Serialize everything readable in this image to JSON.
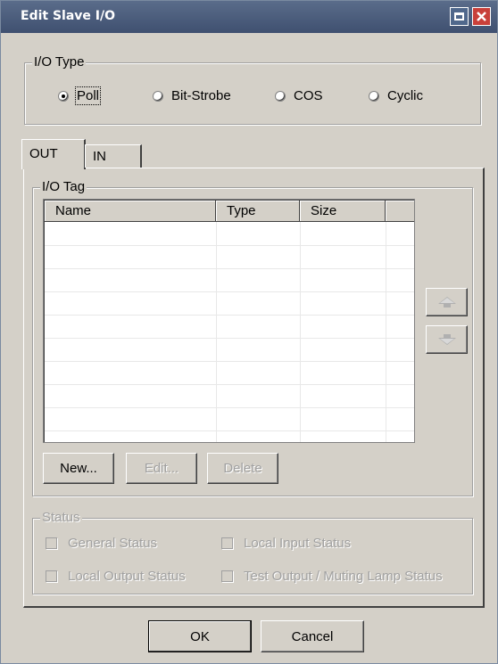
{
  "window": {
    "title": "Edit Slave I/O"
  },
  "io_type": {
    "legend": "I/O Type",
    "options": [
      {
        "label": "Poll",
        "selected": true
      },
      {
        "label": "Bit-Strobe",
        "selected": false
      },
      {
        "label": "COS",
        "selected": false
      },
      {
        "label": "Cyclic",
        "selected": false
      }
    ]
  },
  "tabs": [
    {
      "label": "OUT",
      "active": true
    },
    {
      "label": "IN",
      "active": false
    }
  ],
  "io_tag": {
    "legend": "I/O Tag",
    "columns": [
      "Name",
      "Type",
      "Size"
    ],
    "rows": [],
    "buttons": {
      "new": "New...",
      "edit": "Edit...",
      "delete": "Delete"
    },
    "move_up_icon": "move-up-icon",
    "move_down_icon": "move-down-icon"
  },
  "status": {
    "legend": "Status",
    "items": [
      {
        "label": "General Status",
        "checked": false
      },
      {
        "label": "Local Input Status",
        "checked": false
      },
      {
        "label": "Local Output Status",
        "checked": false
      },
      {
        "label": "Test Output / Muting Lamp Status",
        "checked": false
      }
    ]
  },
  "footer": {
    "ok": "OK",
    "cancel": "Cancel"
  }
}
